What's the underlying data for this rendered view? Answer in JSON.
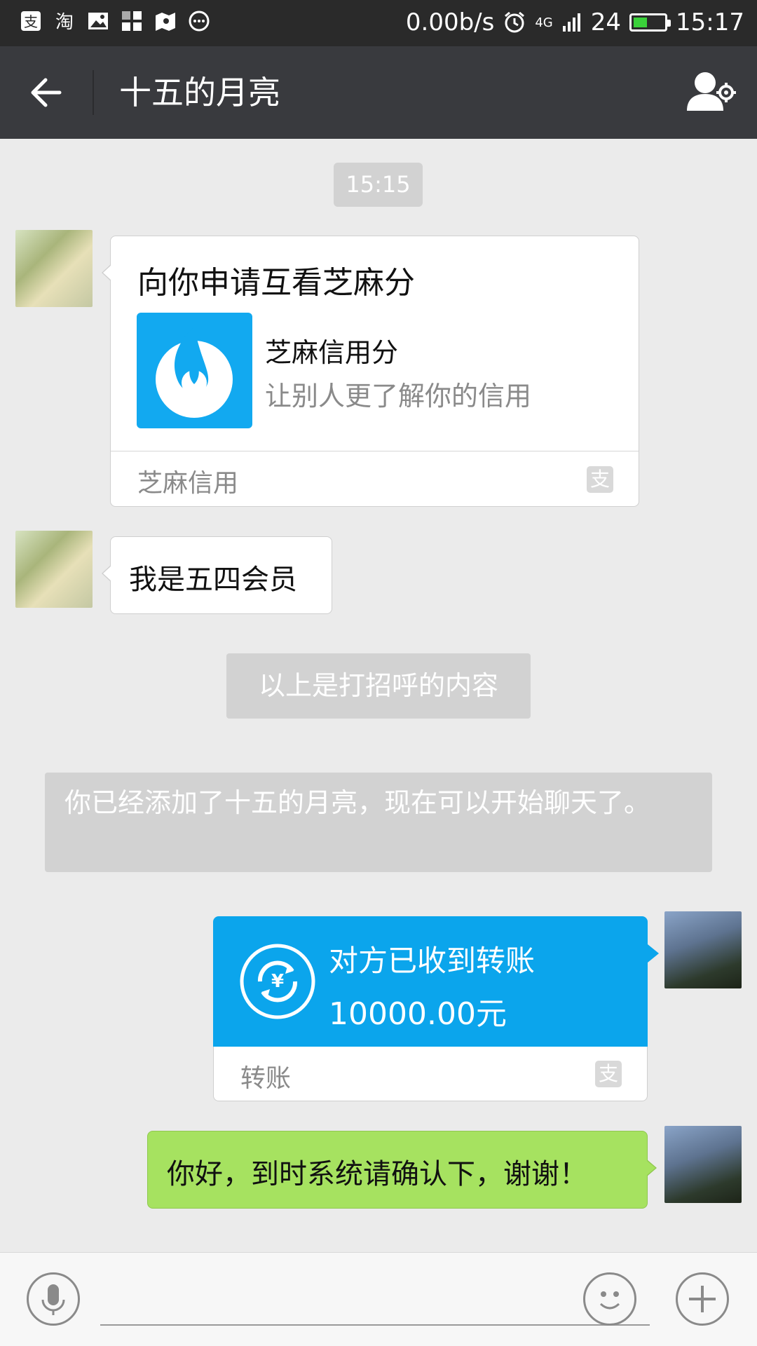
{
  "status_bar": {
    "network_speed": "0.00b/s",
    "network_type": "4G",
    "battery_level": "24",
    "time": "15:17",
    "left_icons": [
      "alipay-icon",
      "taobao-icon",
      "gallery-icon",
      "apps-icon",
      "map-icon",
      "more-icon"
    ]
  },
  "header": {
    "title": "十五的月亮"
  },
  "timestamp": "15:15",
  "messages": {
    "sesame_card": {
      "title": "向你申请互看芝麻分",
      "app_name": "芝麻信用分",
      "app_desc": "让别人更了解你的信用",
      "source": "芝麻信用"
    },
    "member_text": "我是五四会员",
    "greeting_notice": "以上是打招呼的内容",
    "added_notice": "你已经添加了十五的月亮，现在可以开始聊天了。",
    "transfer": {
      "status": "对方已收到转账",
      "amount": "10000.00元",
      "label": "转账"
    },
    "confirm_text": "你好，到时系统请确认下，谢谢！"
  },
  "input": {
    "placeholder": ""
  },
  "colors": {
    "alipay_blue": "#0ba5ec",
    "bubble_green": "#a6e260",
    "header_dark": "#393a3e"
  }
}
